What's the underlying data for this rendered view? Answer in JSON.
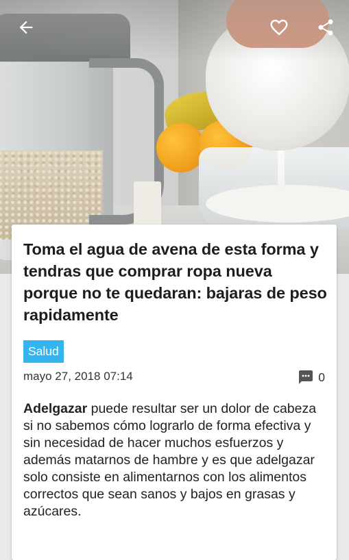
{
  "header": {
    "back_icon": "arrow-left-icon",
    "favorite_icon": "heart-outline-icon",
    "share_icon": "share-icon"
  },
  "article": {
    "title": "Toma el agua de avena de esta forma y tendras que comprar ropa nueva porque no te quedaran: bajaras de peso rapidamente",
    "category": "Salud",
    "date": "mayo 27, 2018 07:14",
    "comment_count": "0",
    "comment_icon": "comment-icon",
    "lead_bold": "Adelgazar",
    "body": " puede resultar ser un dolor de cabeza si no sabemos cómo lograrlo de forma efectiva y sin necesidad de hacer muchos esfuerzos y además matarnos de hambre y es que adelgazar solo consiste en alimentarnos con los alimentos correctos que sean sanos y bajos en grasas y azúcares."
  },
  "colors": {
    "category_badge": "#34b5f0",
    "card_background": "#ffffff",
    "title_text": "#1d1d1d"
  }
}
